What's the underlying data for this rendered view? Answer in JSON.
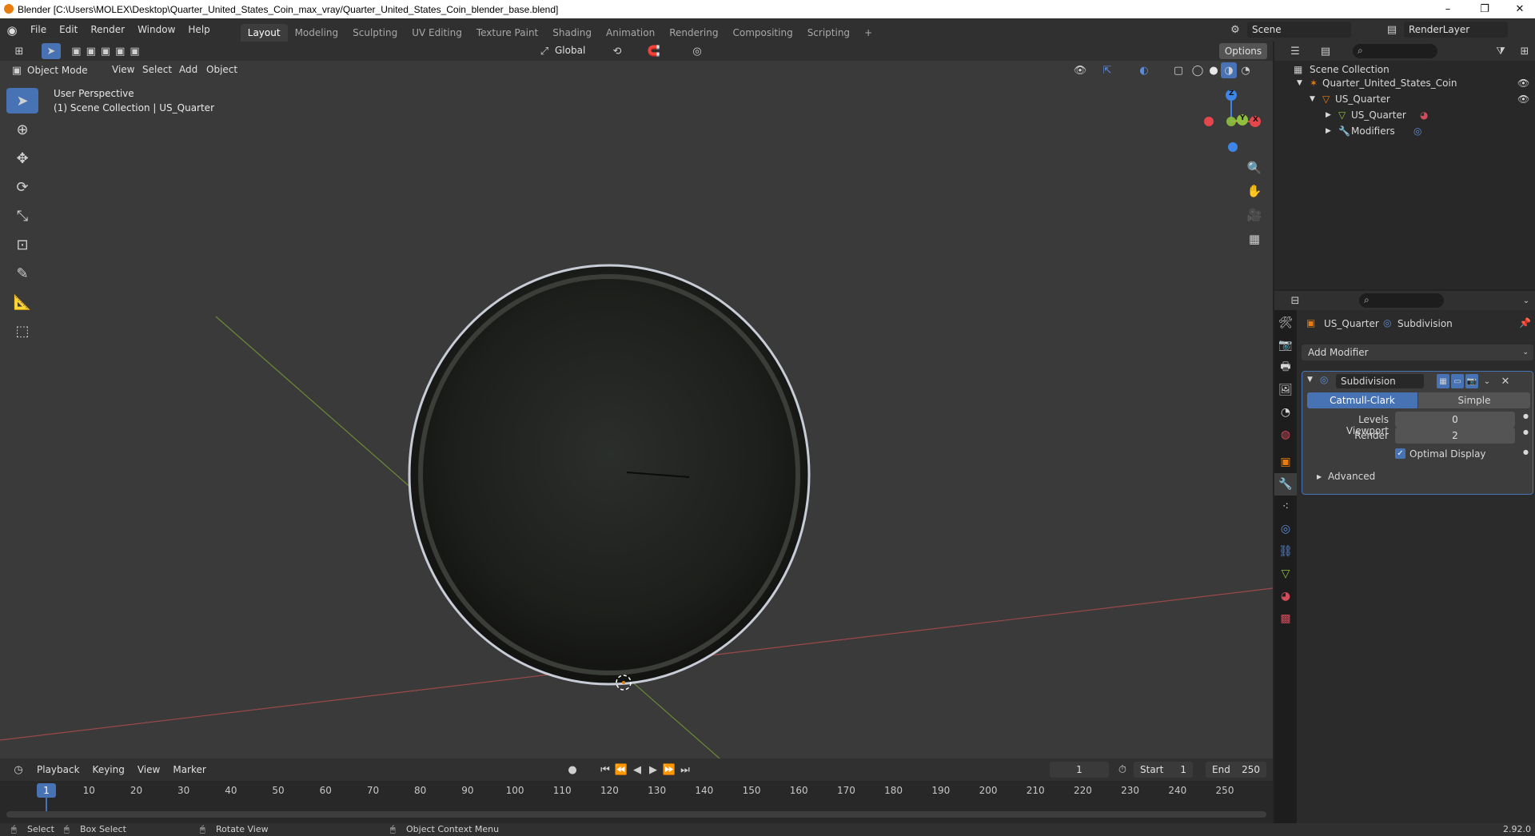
{
  "window": {
    "title": "Blender [C:\\Users\\MOLEX\\Desktop\\Quarter_United_States_Coin_max_vray/Quarter_United_States_Coin_blender_base.blend]",
    "controls": [
      "–",
      "❐",
      "✕"
    ]
  },
  "menubar": {
    "menus": [
      "File",
      "Edit",
      "Render",
      "Window",
      "Help"
    ],
    "workspaces": [
      "Layout",
      "Modeling",
      "Sculpting",
      "UV Editing",
      "Texture Paint",
      "Shading",
      "Animation",
      "Rendering",
      "Compositing",
      "Scripting"
    ],
    "active_workspace": "Layout",
    "add_workspace": "+",
    "scene": "Scene",
    "view_layer": "RenderLayer"
  },
  "viewport": {
    "transform_orientation": "Global",
    "options": "Options",
    "mode": "Object Mode",
    "menus": [
      "View",
      "Select",
      "Add",
      "Object"
    ],
    "overlay_line1": "User Perspective",
    "overlay_line2": "(1) Scene Collection | US_Quarter",
    "gizmo": {
      "x": "X",
      "y": "Y",
      "z": "Z"
    }
  },
  "outliner": {
    "root": "Scene Collection",
    "items": [
      {
        "label": "Quarter_United_States_Coin",
        "depth": 1
      },
      {
        "label": "US_Quarter",
        "depth": 2
      },
      {
        "label": "US_Quarter",
        "depth": 3
      },
      {
        "label": "Modifiers",
        "depth": 3
      }
    ]
  },
  "properties": {
    "breadcrumb_object": "US_Quarter",
    "breadcrumb_modifier": "Subdivision",
    "add_modifier": "Add Modifier",
    "modifier": {
      "name": "Subdivision",
      "type_options": [
        "Catmull-Clark",
        "Simple"
      ],
      "selected_type": "Catmull-Clark",
      "levels_viewport_label": "Levels Viewport",
      "levels_viewport": "0",
      "render_label": "Render",
      "render": "2",
      "optimal_display_label": "Optimal Display",
      "optimal_display": true,
      "advanced_label": "Advanced"
    }
  },
  "timeline": {
    "menus": [
      "Playback",
      "Keying",
      "View",
      "Marker"
    ],
    "current_frame": "1",
    "start_label": "Start",
    "start": "1",
    "end_label": "End",
    "end": "250",
    "ticks": [
      "1",
      "10",
      "20",
      "30",
      "40",
      "50",
      "60",
      "70",
      "80",
      "90",
      "100",
      "110",
      "120",
      "130",
      "140",
      "150",
      "160",
      "170",
      "180",
      "190",
      "200",
      "210",
      "220",
      "230",
      "240",
      "250"
    ]
  },
  "statusbar": {
    "select": "Select",
    "box_select": "Box Select",
    "rotate_view": "Rotate View",
    "context_menu": "Object Context Menu",
    "version": "2.92.0"
  },
  "colors": {
    "accent": "#4772b3",
    "x_axis": "#e2474c",
    "y_axis": "#8ec03d",
    "z_axis": "#3d85e6",
    "orange": "#e87d0d"
  }
}
